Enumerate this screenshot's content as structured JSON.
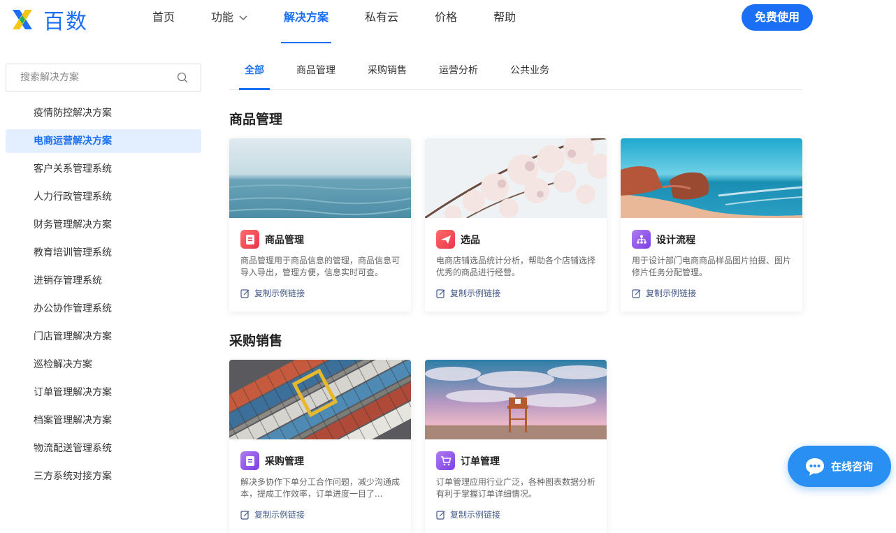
{
  "brand": {
    "name": "百数"
  },
  "nav": {
    "items": [
      {
        "label": "首页"
      },
      {
        "label": "功能"
      },
      {
        "label": "解决方案"
      },
      {
        "label": "私有云"
      },
      {
        "label": "价格"
      },
      {
        "label": "帮助"
      }
    ],
    "cta_label": "免费使用"
  },
  "search": {
    "placeholder": "搜索解决方案"
  },
  "sidebar": {
    "items": [
      {
        "label": "疫情防控解决方案"
      },
      {
        "label": "电商运营解决方案"
      },
      {
        "label": "客户关系管理系统"
      },
      {
        "label": "人力行政管理系统"
      },
      {
        "label": "财务管理解决方案"
      },
      {
        "label": "教育培训管理系统"
      },
      {
        "label": "进销存管理系统"
      },
      {
        "label": "办公协作管理系统"
      },
      {
        "label": "门店管理解决方案"
      },
      {
        "label": "巡检解决方案"
      },
      {
        "label": "订单管理解决方案"
      },
      {
        "label": "档案管理解决方案"
      },
      {
        "label": "物流配送管理系统"
      },
      {
        "label": "三方系统对接方案"
      }
    ],
    "active_index": 1
  },
  "tabs": [
    {
      "label": "全部"
    },
    {
      "label": "商品管理"
    },
    {
      "label": "采购销售"
    },
    {
      "label": "运营分析"
    },
    {
      "label": "公共业务"
    }
  ],
  "sections": [
    {
      "title": "商品管理",
      "cards": [
        {
          "title": "商品管理",
          "desc": "商品管理用于商品信息的管理，商品信息可导入导出，管理方便，信息实时可查。",
          "link": "复制示例链接",
          "icon": "document-icon"
        },
        {
          "title": "选品",
          "desc": "电商店铺选品统计分析，帮助各个店铺选择优秀的商品进行经营。",
          "link": "复制示例链接",
          "icon": "send-icon"
        },
        {
          "title": "设计流程",
          "desc": "用于设计部门电商商品样品图片拍摄、图片修片任务分配管理。",
          "link": "复制示例链接",
          "icon": "flowchart-icon"
        }
      ]
    },
    {
      "title": "采购销售",
      "cards": [
        {
          "title": "采购管理",
          "desc": "解决多协作下单分工合作问题，减少沟通成本，提成工作效率，订单进度一目了...",
          "link": "复制示例链接",
          "icon": "document-icon"
        },
        {
          "title": "订单管理",
          "desc": "订单管理应用行业广泛，各种图表数据分析有利于掌握订单详细情况。",
          "link": "复制示例链接",
          "icon": "cart-icon"
        }
      ]
    }
  ],
  "chat": {
    "label": "在线咨询"
  },
  "colors": {
    "accent": "#1a6ff5",
    "active_bg": "#e3efff"
  }
}
